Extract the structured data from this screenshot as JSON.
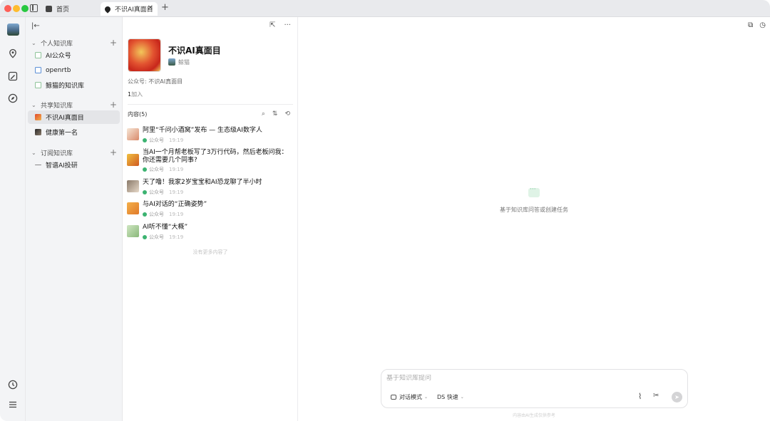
{
  "tabs": [
    {
      "label": "首页",
      "icon": "book-icon"
    },
    {
      "label": "不识AI真面目",
      "icon": "pin-icon",
      "active": true
    }
  ],
  "sidebar": {
    "sections": [
      {
        "title": "个人知识库",
        "items": [
          {
            "label": "AI公众号",
            "icon": "sheet-icon"
          },
          {
            "label": "openrtb",
            "icon": "doc-blue-icon"
          },
          {
            "label": "鲸猫的知识库",
            "icon": "sheet-icon"
          }
        ]
      },
      {
        "title": "共享知识库",
        "items": [
          {
            "label": "不识AI真面目",
            "icon": "kb-cover-icon",
            "active": true
          },
          {
            "label": "健康第一名",
            "icon": "kb-cover-icon"
          }
        ]
      },
      {
        "title": "订阅知识库",
        "items": [
          {
            "label": "智谱AI投研",
            "icon": "dash-icon"
          }
        ]
      }
    ]
  },
  "kb": {
    "title": "不识AI真面目",
    "owner": "鲸猫",
    "description": "公众号: 不识AI真面目",
    "joined_count": "1",
    "joined_label": "加入",
    "content_header": "内容(5)"
  },
  "articles": [
    {
      "title": "阿里“千问小酒窝”发布 — 生态级AI数字人",
      "source": "公众号",
      "time": "19:19"
    },
    {
      "title": "当AI一个月帮老板写了3万行代码，然后老板问我：你还需要几个同事?",
      "source": "公众号",
      "time": "19:19"
    },
    {
      "title": "天了噜！我家2岁宝宝和AI恐龙聊了半小时",
      "source": "公众号",
      "time": "19:19"
    },
    {
      "title": "与AI对话的“正确姿势”",
      "source": "公众号",
      "time": "19:19"
    },
    {
      "title": "AI听不懂“大概”",
      "source": "公众号",
      "time": "19:19"
    }
  ],
  "no_more": "没有更多内容了",
  "right": {
    "empty_text": "基于知识库问答或创建任务",
    "chat_placeholder": "基于知识库提问",
    "mode_label": "对话模式",
    "model_label": "DS 快速",
    "disclaimer": "内容由AI生成仅供参考"
  }
}
